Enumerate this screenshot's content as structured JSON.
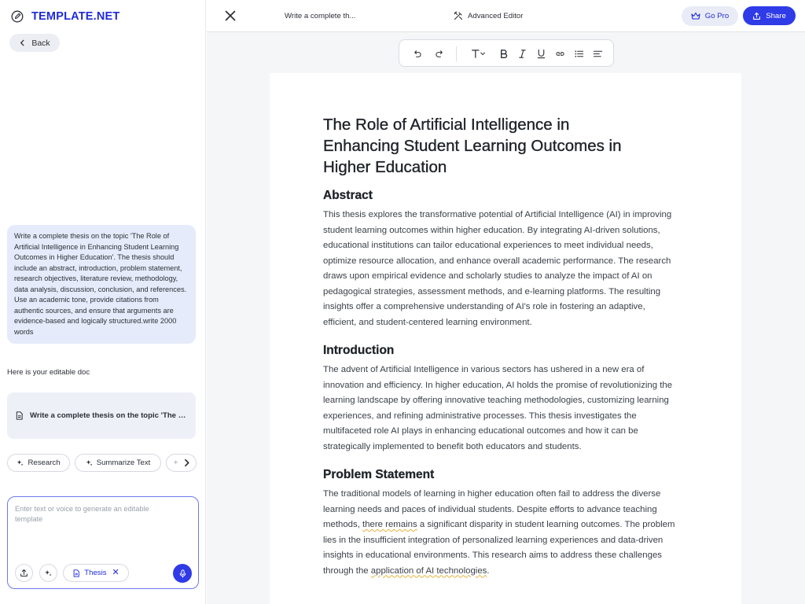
{
  "sidebar": {
    "brand": "TEMPLATE.NET",
    "back_label": "Back",
    "prompt_text": "Write a complete thesis on the topic 'The Role of Artificial Intelligence in Enhancing Student Learning Outcomes in Higher Education'. The thesis should include an abstract, introduction, problem statement, research objectives, literature review, methodology, data analysis, discussion, conclusion, and references. Use an academic tone, provide citations from authentic sources, and ensure that arguments are evidence-based and logically structured.write 2000 words",
    "response_text": "Here is your editable doc",
    "doc_card_title": "Write a complete thesis on the topic 'The Role of Artificial Intelligence in Enhancing Student Learning Outcomes in Higher Education'",
    "chips": {
      "research": "Research",
      "summarize": "Summarize Text"
    },
    "input": {
      "placeholder": "Enter text or voice to generate an editable template",
      "value": "",
      "tag": "Thesis"
    }
  },
  "topbar": {
    "doc_title": "Write a complete th...",
    "advanced_editor": "Advanced Editor",
    "go_pro": "Go Pro",
    "share": "Share"
  },
  "toolbar": {
    "icons": [
      "undo-icon",
      "redo-icon",
      "text-style-icon",
      "bold-icon",
      "italic-icon",
      "underline-icon",
      "link-icon",
      "bullet-list-icon",
      "align-left-icon"
    ]
  },
  "document": {
    "title_lines": [
      "The Role of Artificial Intelligence in",
      "Enhancing Student Learning Outcomes in",
      "Higher Education"
    ],
    "sections": [
      {
        "heading": "Abstract",
        "lines": [
          "This thesis explores the transformative potential of Artificial Intelligence (AI) in improving",
          "student learning outcomes within higher education. By integrating AI-driven solutions,",
          "educational institutions can tailor educational experiences to meet individual needs,",
          "optimize resource allocation, and enhance overall academic performance. The research",
          "draws upon empirical evidence and scholarly studies to analyze the impact of AI on",
          "pedagogical strategies, assessment methods, and e-learning platforms. The resulting",
          "insights offer a comprehensive understanding of AI's role in fostering an adaptive,",
          "efficient, and student-centered learning environment."
        ]
      },
      {
        "heading": "Introduction",
        "lines": [
          "The advent of Artificial Intelligence in various sectors has ushered in a new era of",
          "innovation and efficiency. In higher education, AI holds the promise of revolutionizing the",
          "learning landscape by offering innovative teaching methodologies, customizing learning",
          "experiences, and refining administrative processes. This thesis investigates the",
          "multifaceted role AI plays in enhancing educational outcomes and how it can be",
          "strategically implemented to benefit both educators and students."
        ]
      },
      {
        "heading": "Problem Statement",
        "lines": [
          "The traditional models of learning in higher education often fail to address the diverse",
          "learning needs and paces of individual students. Despite efforts to advance teaching",
          "methods, ",
          "lies in the insufficient integration of personalized learning experiences and data-driven",
          "insights in educational environments. This research aims to address these challenges",
          "through the "
        ],
        "line3_underlined": "there remains",
        "line3_rest": " a significant disparity in student learning outcomes. The problem",
        "line6_underlined": "application of AI technologies",
        "line6_rest": "."
      }
    ]
  },
  "colors": {
    "brand": "#1f2bd6",
    "accent": "#2f3be6",
    "prompt_bg": "#e6ebfb",
    "underline_spelling": "#e3b23c"
  }
}
